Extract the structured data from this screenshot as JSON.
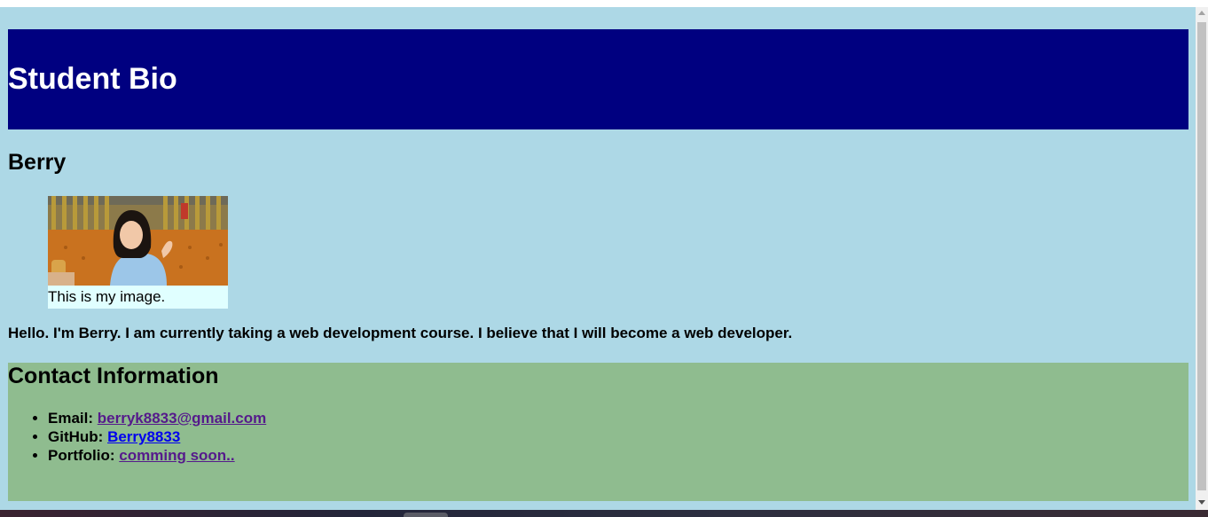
{
  "header": {
    "title": "Student Bio"
  },
  "profile": {
    "name": "Berry",
    "image_caption": "This is my image.",
    "bio": "Hello. I'm Berry. I am currently taking a web development course. I believe that I will become a web developer."
  },
  "contact": {
    "heading": "Contact Information",
    "items": [
      {
        "label": "Email:",
        "link_text": "berryk8833@gmail.com",
        "visited": true
      },
      {
        "label": "GitHub:",
        "link_text": "Berry8833",
        "visited": false
      },
      {
        "label": "Portfolio:",
        "link_text": "comming soon..",
        "visited": true
      }
    ]
  },
  "colors": {
    "page_background": "#add8e6",
    "header_background": "#000080",
    "header_text": "#ffffff",
    "caption_background": "#e0ffff",
    "contact_background": "#8fbc8f",
    "link_visited": "#551a8b",
    "link_unvisited": "#0000ee"
  },
  "icons": {
    "scroll_up": "scroll-up-arrow-icon",
    "scroll_down": "scroll-down-arrow-icon"
  }
}
